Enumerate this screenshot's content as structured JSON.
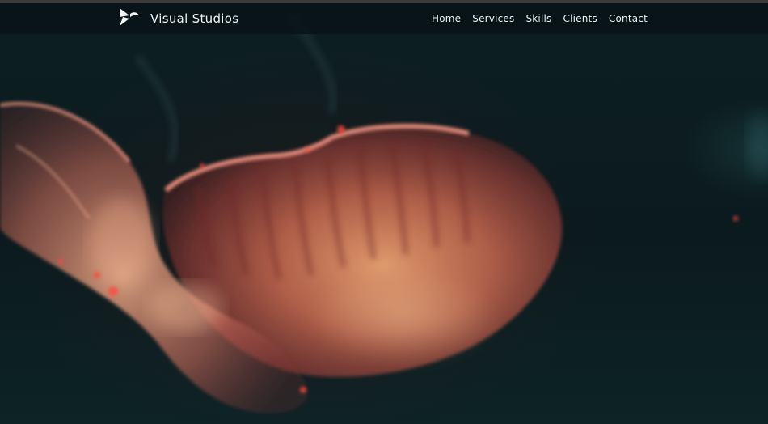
{
  "header": {
    "brand": {
      "title": "Visual Studios",
      "logo_icon": "bird-logo-icon"
    },
    "nav": [
      {
        "label": "Home"
      },
      {
        "label": "Services"
      },
      {
        "label": "Skills"
      },
      {
        "label": "Clients"
      },
      {
        "label": "Contact"
      }
    ]
  },
  "hero": {
    "image": "jellyfish-background",
    "colors": {
      "background": "#0b1a1d",
      "jellyfish_main": "#d77a5a",
      "jellyfish_edge": "#ff8a7a"
    }
  }
}
